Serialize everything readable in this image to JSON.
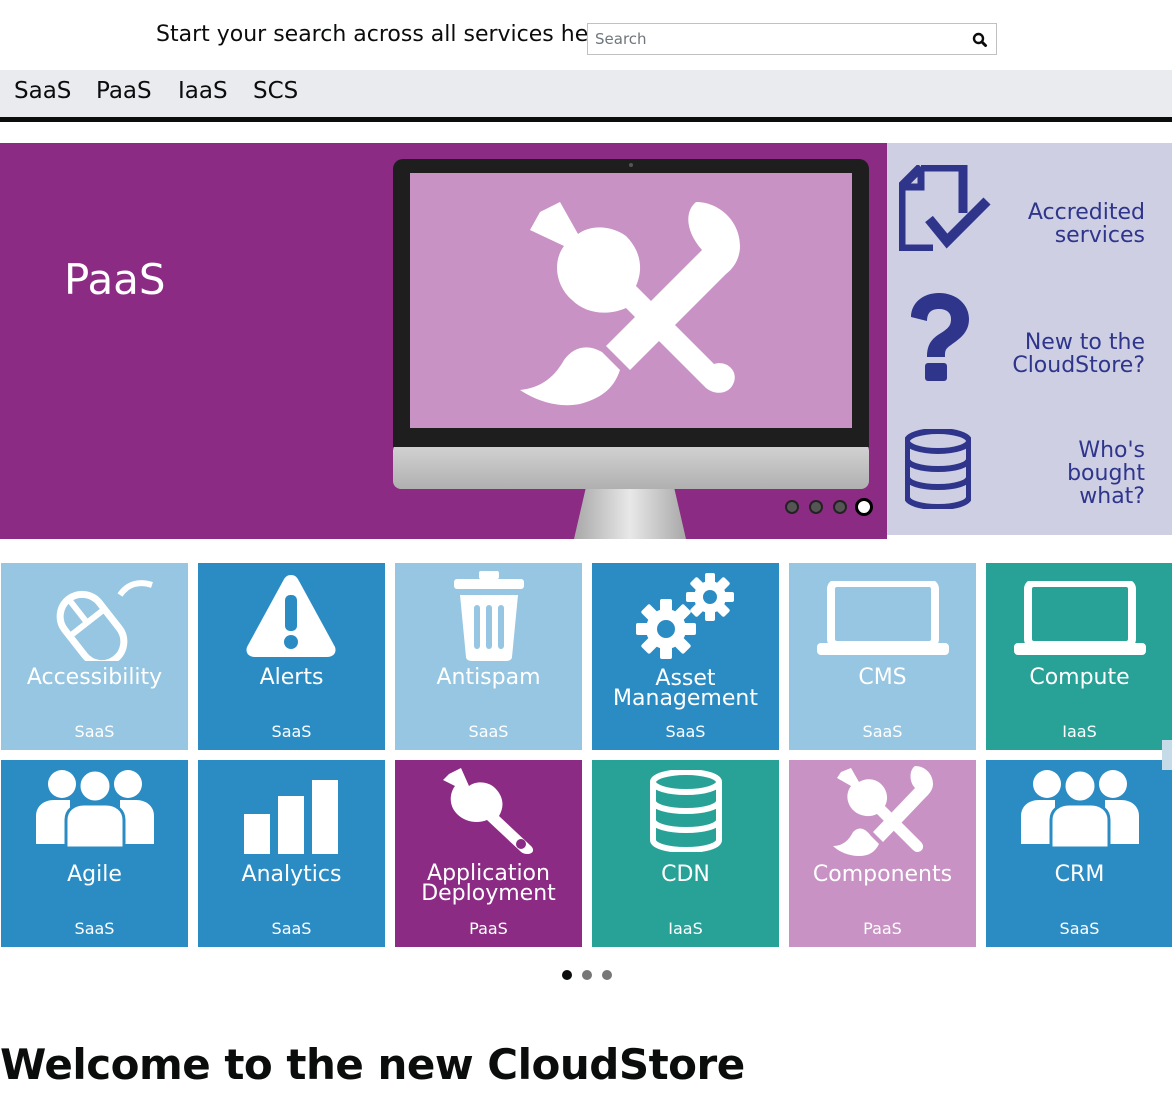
{
  "search": {
    "prompt": "Start your search across all services here",
    "placeholder": "Search"
  },
  "nav": {
    "items": [
      {
        "label": "SaaS"
      },
      {
        "label": "PaaS"
      },
      {
        "label": "IaaS"
      },
      {
        "label": "SCS"
      }
    ]
  },
  "hero": {
    "title": "PaaS",
    "slide_count": 4,
    "active_slide": 4,
    "icon": "wrench-and-brush-icon"
  },
  "side_links": [
    {
      "label_line1": "Accredited",
      "label_line2": "services",
      "icon": "document-check-icon"
    },
    {
      "label_line1": "New to the",
      "label_line2": "CloudStore?",
      "icon": "question-mark-icon"
    },
    {
      "label_line1": "Who's",
      "label_line2": "bought",
      "label_line3": "what?",
      "icon": "database-icon"
    }
  ],
  "tiles": [
    {
      "name": "Accessibility",
      "category": "SaaS",
      "icon": "mouse-icon",
      "color": "#96c6e1"
    },
    {
      "name": "Alerts",
      "category": "SaaS",
      "icon": "warning-icon",
      "color": "#2b8cc4"
    },
    {
      "name": "Antispam",
      "category": "SaaS",
      "icon": "trash-icon",
      "color": "#96c6e1"
    },
    {
      "name_line1": "Asset",
      "name_line2": "Management",
      "category": "SaaS",
      "icon": "gears-icon",
      "color": "#2b8cc4"
    },
    {
      "name": "CMS",
      "category": "SaaS",
      "icon": "laptop-icon",
      "color": "#96c6e1"
    },
    {
      "name": "Compute",
      "category": "IaaS",
      "icon": "laptop-icon",
      "color": "#28a197"
    },
    {
      "name": "Agile",
      "category": "SaaS",
      "icon": "people-icon",
      "color": "#2b8cc4"
    },
    {
      "name": "Analytics",
      "category": "SaaS",
      "icon": "bar-chart-icon",
      "color": "#2b8cc4"
    },
    {
      "name_line1": "Application",
      "name_line2": "Deployment",
      "category": "PaaS",
      "icon": "wrench-icon",
      "color": "#8b2b84"
    },
    {
      "name": "CDN",
      "category": "IaaS",
      "icon": "database-icon",
      "color": "#28a197"
    },
    {
      "name": "Components",
      "category": "PaaS",
      "icon": "wrench-and-brush-icon",
      "color": "#c892c4"
    },
    {
      "name": "CRM",
      "category": "SaaS",
      "icon": "people-icon",
      "color": "#2b8cc4"
    }
  ],
  "tile_pager": {
    "count": 3,
    "active": 1
  },
  "welcome": {
    "heading": "Welcome to the new CloudStore"
  },
  "colors": {
    "purple": "#8b2b84",
    "lilac": "#c892c4",
    "navy": "#2e358b",
    "panel": "#cfcfe4",
    "blue": "#2b8cc4",
    "light_blue": "#96c6e1",
    "teal": "#28a197"
  }
}
